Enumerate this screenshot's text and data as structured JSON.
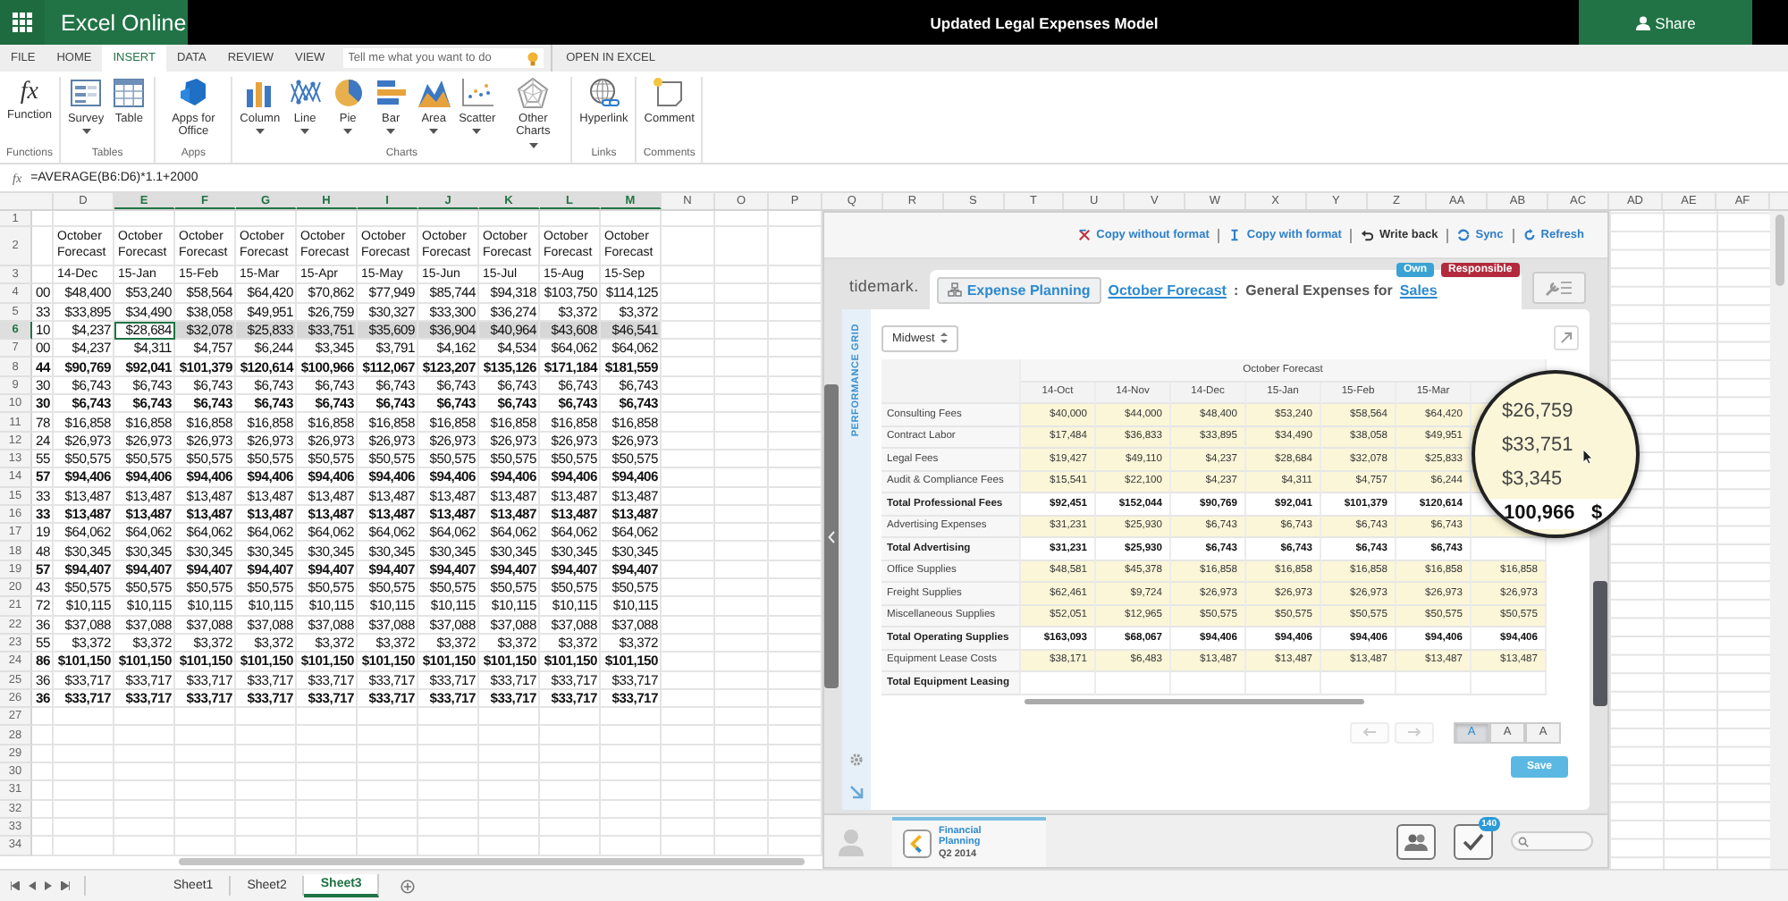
{
  "title_bar": {
    "app_name": "Excel Online",
    "document_title": "Updated Legal Expenses Model",
    "share_button": "Share"
  },
  "ribbon_tabs": [
    {
      "label": "FILE",
      "selected": false
    },
    {
      "label": "HOME",
      "selected": false
    },
    {
      "label": "INSERT",
      "selected": true
    },
    {
      "label": "DATA",
      "selected": false
    },
    {
      "label": "REVIEW",
      "selected": false
    },
    {
      "label": "VIEW",
      "selected": false
    }
  ],
  "tell_me": {
    "placeholder": "Tell me what you want to do"
  },
  "open_in_excel": "OPEN IN EXCEL",
  "ribbon_groups": [
    {
      "name": "Functions",
      "commands": [
        {
          "label": "Function",
          "glyph": "fx",
          "dropdown": false
        }
      ]
    },
    {
      "name": "Tables",
      "commands": [
        {
          "label": "Survey",
          "dropdown": true
        },
        {
          "label": "Table",
          "dropdown": false
        }
      ]
    },
    {
      "name": "Apps",
      "commands": [
        {
          "label": "Apps for Office",
          "dropdown": false
        }
      ]
    },
    {
      "name": "Charts",
      "commands": [
        {
          "label": "Column",
          "dropdown": true
        },
        {
          "label": "Line",
          "dropdown": true
        },
        {
          "label": "Pie",
          "dropdown": true
        },
        {
          "label": "Bar",
          "dropdown": true
        },
        {
          "label": "Area",
          "dropdown": true
        },
        {
          "label": "Scatter",
          "dropdown": true
        },
        {
          "label": "Other Charts",
          "dropdown": true
        }
      ]
    },
    {
      "name": "Links",
      "commands": [
        {
          "label": "Hyperlink",
          "dropdown": false
        }
      ]
    },
    {
      "name": "Comments",
      "commands": [
        {
          "label": "Comment",
          "dropdown": false
        }
      ]
    }
  ],
  "formula_bar": {
    "glyph": "fx",
    "formula": "=AVERAGE(B6:D6)*1.1+2000"
  },
  "grid": {
    "columns": [
      {
        "label": "D",
        "selected": false
      },
      {
        "label": "E",
        "selected": true
      },
      {
        "label": "F",
        "selected": true
      },
      {
        "label": "G",
        "selected": true
      },
      {
        "label": "H",
        "selected": true
      },
      {
        "label": "I",
        "selected": true
      },
      {
        "label": "J",
        "selected": true
      },
      {
        "label": "K",
        "selected": true
      },
      {
        "label": "L",
        "selected": true
      },
      {
        "label": "M",
        "selected": true
      },
      {
        "label": "N",
        "selected": false
      },
      {
        "label": "O",
        "selected": false
      },
      {
        "label": "P",
        "selected": false
      },
      {
        "label": "Q",
        "selected": false
      },
      {
        "label": "R",
        "selected": false
      },
      {
        "label": "S",
        "selected": false
      },
      {
        "label": "T",
        "selected": false
      },
      {
        "label": "U",
        "selected": false
      },
      {
        "label": "V",
        "selected": false
      },
      {
        "label": "W",
        "selected": false
      },
      {
        "label": "X",
        "selected": false
      },
      {
        "label": "Y",
        "selected": false
      },
      {
        "label": "Z",
        "selected": false
      },
      {
        "label": "AA",
        "selected": false
      },
      {
        "label": "AB",
        "selected": false
      },
      {
        "label": "AC",
        "selected": false
      },
      {
        "label": "AD",
        "selected": false
      },
      {
        "label": "AE",
        "selected": false
      },
      {
        "label": "AF",
        "selected": false
      }
    ],
    "rows": [
      {
        "number": "1",
        "selected": false,
        "kind": "blank"
      },
      {
        "number": "2",
        "selected": false,
        "bold": false,
        "kind": "text",
        "cells": [
          null,
          "October Forecast",
          "October Forecast",
          "October Forecast",
          "October Forecast",
          "October Forecast",
          "October Forecast",
          "October Forecast",
          "October Forecast",
          "October Forecast",
          "October Forecast"
        ]
      },
      {
        "number": "3",
        "selected": false,
        "bold": false,
        "kind": "text",
        "cells": [
          null,
          "14-Dec",
          "15-Jan",
          "15-Feb",
          "15-Mar",
          "15-Apr",
          "15-May",
          "15-Jun",
          "15-Jul",
          "15-Aug",
          "15-Sep"
        ]
      },
      {
        "number": "4",
        "selected": false,
        "bold": false,
        "kind": "number",
        "cells": [
          "00",
          "$48,400",
          "$53,240",
          "$58,564",
          "$64,420",
          "$70,862",
          "$77,949",
          "$85,744",
          "$94,318",
          "$103,750",
          "$114,125"
        ]
      },
      {
        "number": "5",
        "selected": false,
        "bold": false,
        "kind": "number",
        "cells": [
          "33",
          "$33,895",
          "$34,490",
          "$38,058",
          "$49,951",
          "$26,759",
          "$30,327",
          "$33,300",
          "$36,274",
          "$3,372",
          "$3,372"
        ]
      },
      {
        "number": "6",
        "selected": true,
        "bold": false,
        "kind": "number",
        "cells": [
          "10",
          "$4,237",
          "$28,684",
          "$32,078",
          "$25,833",
          "$33,751",
          "$35,609",
          "$36,904",
          "$40,964",
          "$43,608",
          "$46,541"
        ]
      },
      {
        "number": "7",
        "selected": false,
        "bold": false,
        "kind": "number",
        "cells": [
          "00",
          "$4,237",
          "$4,311",
          "$4,757",
          "$6,244",
          "$3,345",
          "$3,791",
          "$4,162",
          "$4,534",
          "$64,062",
          "$64,062"
        ]
      },
      {
        "number": "8",
        "selected": false,
        "bold": true,
        "kind": "number",
        "cells": [
          "44",
          "$90,769",
          "$92,041",
          "$101,379",
          "$120,614",
          "$100,966",
          "$112,067",
          "$123,207",
          "$135,126",
          "$171,184",
          "$181,559"
        ]
      },
      {
        "number": "9",
        "selected": false,
        "bold": false,
        "kind": "number",
        "cells": [
          "30",
          "$6,743",
          "$6,743",
          "$6,743",
          "$6,743",
          "$6,743",
          "$6,743",
          "$6,743",
          "$6,743",
          "$6,743",
          "$6,743"
        ]
      },
      {
        "number": "10",
        "selected": false,
        "bold": true,
        "kind": "number",
        "cells": [
          "30",
          "$6,743",
          "$6,743",
          "$6,743",
          "$6,743",
          "$6,743",
          "$6,743",
          "$6,743",
          "$6,743",
          "$6,743",
          "$6,743"
        ]
      },
      {
        "number": "11",
        "selected": false,
        "bold": false,
        "kind": "number",
        "cells": [
          "78",
          "$16,858",
          "$16,858",
          "$16,858",
          "$16,858",
          "$16,858",
          "$16,858",
          "$16,858",
          "$16,858",
          "$16,858",
          "$16,858"
        ]
      },
      {
        "number": "12",
        "selected": false,
        "bold": false,
        "kind": "number",
        "cells": [
          "24",
          "$26,973",
          "$26,973",
          "$26,973",
          "$26,973",
          "$26,973",
          "$26,973",
          "$26,973",
          "$26,973",
          "$26,973",
          "$26,973"
        ]
      },
      {
        "number": "13",
        "selected": false,
        "bold": false,
        "kind": "number",
        "cells": [
          "55",
          "$50,575",
          "$50,575",
          "$50,575",
          "$50,575",
          "$50,575",
          "$50,575",
          "$50,575",
          "$50,575",
          "$50,575",
          "$50,575"
        ]
      },
      {
        "number": "14",
        "selected": false,
        "bold": true,
        "kind": "number",
        "cells": [
          "57",
          "$94,406",
          "$94,406",
          "$94,406",
          "$94,406",
          "$94,406",
          "$94,406",
          "$94,406",
          "$94,406",
          "$94,406",
          "$94,406"
        ]
      },
      {
        "number": "15",
        "selected": false,
        "bold": false,
        "kind": "number",
        "cells": [
          "33",
          "$13,487",
          "$13,487",
          "$13,487",
          "$13,487",
          "$13,487",
          "$13,487",
          "$13,487",
          "$13,487",
          "$13,487",
          "$13,487"
        ]
      },
      {
        "number": "16",
        "selected": false,
        "bold": true,
        "kind": "number",
        "cells": [
          "33",
          "$13,487",
          "$13,487",
          "$13,487",
          "$13,487",
          "$13,487",
          "$13,487",
          "$13,487",
          "$13,487",
          "$13,487",
          "$13,487"
        ]
      },
      {
        "number": "17",
        "selected": false,
        "bold": false,
        "kind": "number",
        "cells": [
          "19",
          "$64,062",
          "$64,062",
          "$64,062",
          "$64,062",
          "$64,062",
          "$64,062",
          "$64,062",
          "$64,062",
          "$64,062",
          "$64,062"
        ]
      },
      {
        "number": "18",
        "selected": false,
        "bold": false,
        "kind": "number",
        "cells": [
          "48",
          "$30,345",
          "$30,345",
          "$30,345",
          "$30,345",
          "$30,345",
          "$30,345",
          "$30,345",
          "$30,345",
          "$30,345",
          "$30,345"
        ]
      },
      {
        "number": "19",
        "selected": false,
        "bold": true,
        "kind": "number",
        "cells": [
          "57",
          "$94,407",
          "$94,407",
          "$94,407",
          "$94,407",
          "$94,407",
          "$94,407",
          "$94,407",
          "$94,407",
          "$94,407",
          "$94,407"
        ]
      },
      {
        "number": "20",
        "selected": false,
        "bold": false,
        "kind": "number",
        "cells": [
          "43",
          "$50,575",
          "$50,575",
          "$50,575",
          "$50,575",
          "$50,575",
          "$50,575",
          "$50,575",
          "$50,575",
          "$50,575",
          "$50,575"
        ]
      },
      {
        "number": "21",
        "selected": false,
        "bold": false,
        "kind": "number",
        "cells": [
          "72",
          "$10,115",
          "$10,115",
          "$10,115",
          "$10,115",
          "$10,115",
          "$10,115",
          "$10,115",
          "$10,115",
          "$10,115",
          "$10,115"
        ]
      },
      {
        "number": "22",
        "selected": false,
        "bold": false,
        "kind": "number",
        "cells": [
          "36",
          "$37,088",
          "$37,088",
          "$37,088",
          "$37,088",
          "$37,088",
          "$37,088",
          "$37,088",
          "$37,088",
          "$37,088",
          "$37,088"
        ]
      },
      {
        "number": "23",
        "selected": false,
        "bold": false,
        "kind": "number",
        "cells": [
          "55",
          "$3,372",
          "$3,372",
          "$3,372",
          "$3,372",
          "$3,372",
          "$3,372",
          "$3,372",
          "$3,372",
          "$3,372",
          "$3,372"
        ]
      },
      {
        "number": "24",
        "selected": false,
        "bold": true,
        "kind": "number",
        "cells": [
          "86",
          "$101,150",
          "$101,150",
          "$101,150",
          "$101,150",
          "$101,150",
          "$101,150",
          "$101,150",
          "$101,150",
          "$101,150",
          "$101,150"
        ]
      },
      {
        "number": "25",
        "selected": false,
        "bold": false,
        "kind": "number",
        "cells": [
          "36",
          "$33,717",
          "$33,717",
          "$33,717",
          "$33,717",
          "$33,717",
          "$33,717",
          "$33,717",
          "$33,717",
          "$33,717",
          "$33,717"
        ]
      },
      {
        "number": "26",
        "selected": false,
        "bold": true,
        "kind": "number",
        "cells": [
          "36",
          "$33,717",
          "$33,717",
          "$33,717",
          "$33,717",
          "$33,717",
          "$33,717",
          "$33,717",
          "$33,717",
          "$33,717",
          "$33,717"
        ]
      },
      {
        "number": "27",
        "selected": false,
        "kind": "blank"
      },
      {
        "number": "28",
        "selected": false,
        "kind": "blank"
      },
      {
        "number": "29",
        "selected": false,
        "kind": "blank"
      },
      {
        "number": "30",
        "selected": false,
        "kind": "blank"
      },
      {
        "number": "31",
        "selected": false,
        "kind": "blank"
      },
      {
        "number": "32",
        "selected": false,
        "kind": "blank"
      },
      {
        "number": "33",
        "selected": false,
        "kind": "blank"
      },
      {
        "number": "34",
        "selected": false,
        "kind": "blank"
      }
    ]
  },
  "tidemark_panel": {
    "toolbar": [
      {
        "label": "Copy without format",
        "kind": "link"
      },
      {
        "label": "Copy with format",
        "kind": "link"
      },
      {
        "label": "Write back",
        "kind": "plain"
      },
      {
        "label": "Sync",
        "kind": "link"
      },
      {
        "label": "Refresh",
        "kind": "link"
      }
    ],
    "logo": "tidemark.",
    "module_button": "Expense Planning",
    "breadcrumb": {
      "link": "October Forecast",
      "separator": ":",
      "text": "General Expenses for",
      "target": "Sales"
    },
    "badges": [
      {
        "label": "Own",
        "color": "#3aa3d3"
      },
      {
        "label": "Responsible",
        "color": "#b22a3c"
      }
    ],
    "side_label": "PERFORMANCE GRID",
    "region_filter": "Midwest",
    "table": {
      "group_header": "October Forecast",
      "columns": [
        "14-Oct",
        "14-Nov",
        "14-Dec",
        "15-Jan",
        "15-Feb",
        "15-Mar"
      ],
      "rows": [
        {
          "label": "Consulting Fees",
          "kind": "input",
          "values": [
            "$40,000",
            "$44,000",
            "$48,400",
            "$53,240",
            "$58,564",
            "$64,420"
          ]
        },
        {
          "label": "Contract Labor",
          "kind": "input",
          "values": [
            "$17,484",
            "$36,833",
            "$33,895",
            "$34,490",
            "$38,058",
            "$49,951"
          ]
        },
        {
          "label": "Legal Fees",
          "kind": "input",
          "values": [
            "$19,427",
            "$49,110",
            "$4,237",
            "$28,684",
            "$32,078",
            "$25,833"
          ]
        },
        {
          "label": "Audit & Compliance Fees",
          "kind": "input",
          "values": [
            "$15,541",
            "$22,100",
            "$4,237",
            "$4,311",
            "$4,757",
            "$6,244"
          ]
        },
        {
          "label": "Total Professional Fees",
          "kind": "total",
          "values": [
            "$92,451",
            "$152,044",
            "$90,769",
            "$92,041",
            "$101,379",
            "$120,614"
          ]
        },
        {
          "label": "Advertising Expenses",
          "kind": "input",
          "values": [
            "$31,231",
            "$25,930",
            "$6,743",
            "$6,743",
            "$6,743",
            "$6,743"
          ]
        },
        {
          "label": "Total Advertising",
          "kind": "total",
          "values": [
            "$31,231",
            "$25,930",
            "$6,743",
            "$6,743",
            "$6,743",
            "$6,743"
          ]
        },
        {
          "label": "Office Supplies",
          "kind": "input",
          "values": [
            "$48,581",
            "$45,378",
            "$16,858",
            "$16,858",
            "$16,858",
            "$16,858",
            "$16,858"
          ]
        },
        {
          "label": "Freight Supplies",
          "kind": "input",
          "values": [
            "$62,461",
            "$9,724",
            "$26,973",
            "$26,973",
            "$26,973",
            "$26,973",
            "$26,973"
          ]
        },
        {
          "label": "Miscellaneous Supplies",
          "kind": "input",
          "values": [
            "$52,051",
            "$12,965",
            "$50,575",
            "$50,575",
            "$50,575",
            "$50,575",
            "$50,575"
          ]
        },
        {
          "label": "Total Operating Supplies",
          "kind": "total",
          "values": [
            "$163,093",
            "$68,067",
            "$94,406",
            "$94,406",
            "$94,406",
            "$94,406",
            "$94,406"
          ]
        },
        {
          "label": "Equipment Lease Costs",
          "kind": "input",
          "values": [
            "$38,171",
            "$6,483",
            "$13,487",
            "$13,487",
            "$13,487",
            "$13,487",
            "$13,487"
          ]
        },
        {
          "label": "Total Equipment Leasing",
          "kind": "total"
        }
      ]
    },
    "magnifier": [
      {
        "text": "$26,759",
        "bold": false
      },
      {
        "text": "$33,751",
        "bold": false
      },
      {
        "text": "$3,345",
        "bold": false
      },
      {
        "text": "100,966",
        "bold": true,
        "next": "$"
      }
    ],
    "history_buttons": [
      {
        "kind": "undo",
        "disabled": true
      },
      {
        "kind": "redo",
        "disabled": true
      }
    ],
    "font_sizes": [
      {
        "label": "A",
        "selected": true
      },
      {
        "label": "A",
        "selected": false
      },
      {
        "label": "A",
        "selected": false
      }
    ],
    "save_button": "Save",
    "footer": {
      "app_title": "Financial Planning",
      "app_subtitle": "Q2 2014",
      "notification_count": "140"
    }
  },
  "sheet_tabs": [
    {
      "label": "Sheet1",
      "selected": false
    },
    {
      "label": "Sheet2",
      "selected": false
    },
    {
      "label": "Sheet3",
      "selected": true
    }
  ]
}
